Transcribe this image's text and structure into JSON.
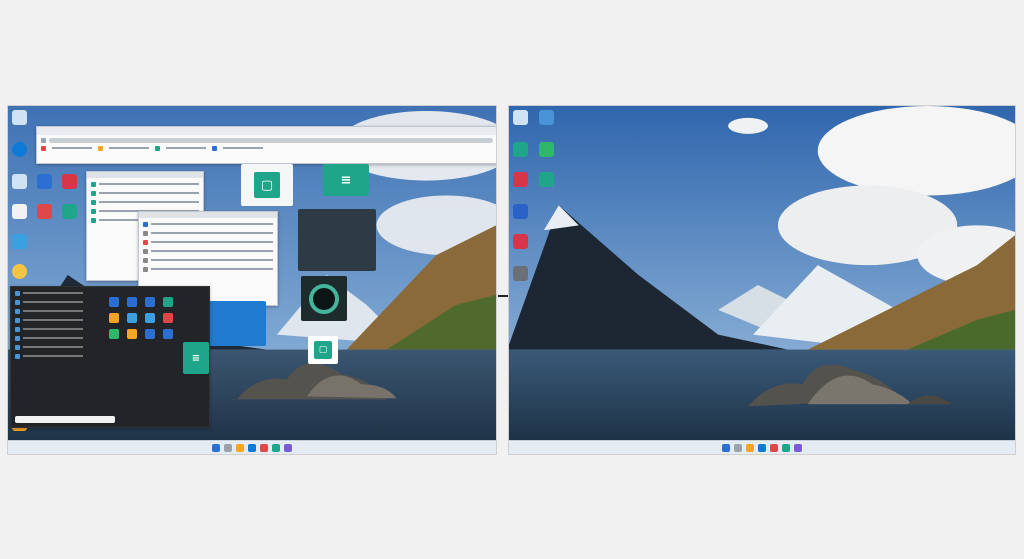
{
  "left_panel": {
    "desktop_icons": [
      {
        "label": "",
        "icon": "recycle-bin-icon",
        "color": "#cfe3f5"
      },
      {
        "label": "",
        "icon": "edge-icon",
        "color": "#0f7ad6"
      },
      {
        "label": "",
        "icon": "recycle-bin-icon",
        "color": "#cfe3f5"
      },
      {
        "label": "",
        "icon": "app-icon",
        "color": "#2a6fd1"
      },
      {
        "label": "",
        "icon": "app-icon",
        "color": "#d7354a"
      },
      {
        "label": "",
        "icon": "app-icon",
        "color": "#1fa58a"
      },
      {
        "label": "",
        "icon": "app-icon",
        "color": "#f2f2f2"
      },
      {
        "label": "",
        "icon": "app-icon",
        "color": "#e04848"
      },
      {
        "label": "",
        "icon": "app-icon",
        "color": "#3aa0e0"
      },
      {
        "label": "",
        "icon": "chrome-icon",
        "color": "#f4c542"
      },
      {
        "label": "",
        "icon": "edge-icon",
        "color": "#1b8bd8"
      },
      {
        "label": "",
        "icon": "app-icon",
        "color": "#3c8de0"
      },
      {
        "label": "",
        "icon": "app-icon",
        "color": "#2b7fd6"
      },
      {
        "label": "",
        "icon": "app-icon",
        "color": "#f4a623"
      }
    ],
    "tray_time": "",
    "tray_date": ""
  },
  "right_panel": {
    "desktop_icons": [
      {
        "label": "",
        "icon": "recycle-bin-icon",
        "color": "#cfe3f5"
      },
      {
        "label": "",
        "icon": "folder-icon",
        "color": "#4a93d6"
      },
      {
        "label": "",
        "icon": "app-icon",
        "color": "#1fa58a"
      },
      {
        "label": "",
        "icon": "app-icon",
        "color": "#2fb86a"
      },
      {
        "label": "",
        "icon": "app-icon",
        "color": "#d7354a"
      },
      {
        "label": "",
        "icon": "app-icon",
        "color": "#1fa58a"
      },
      {
        "label": "",
        "icon": "app-icon",
        "color": "#2b62c8"
      },
      {
        "label": "",
        "icon": "app-icon",
        "color": "#d7354a"
      },
      {
        "label": "",
        "icon": "app-icon",
        "color": "#6b6f78"
      }
    ],
    "tray_time": "",
    "tray_date": ""
  },
  "colors": {
    "sky_top": "#3f72b4",
    "lake": "#243c54",
    "accent_teal": "#1fa58a",
    "taskbar": "#e4ebf3"
  }
}
